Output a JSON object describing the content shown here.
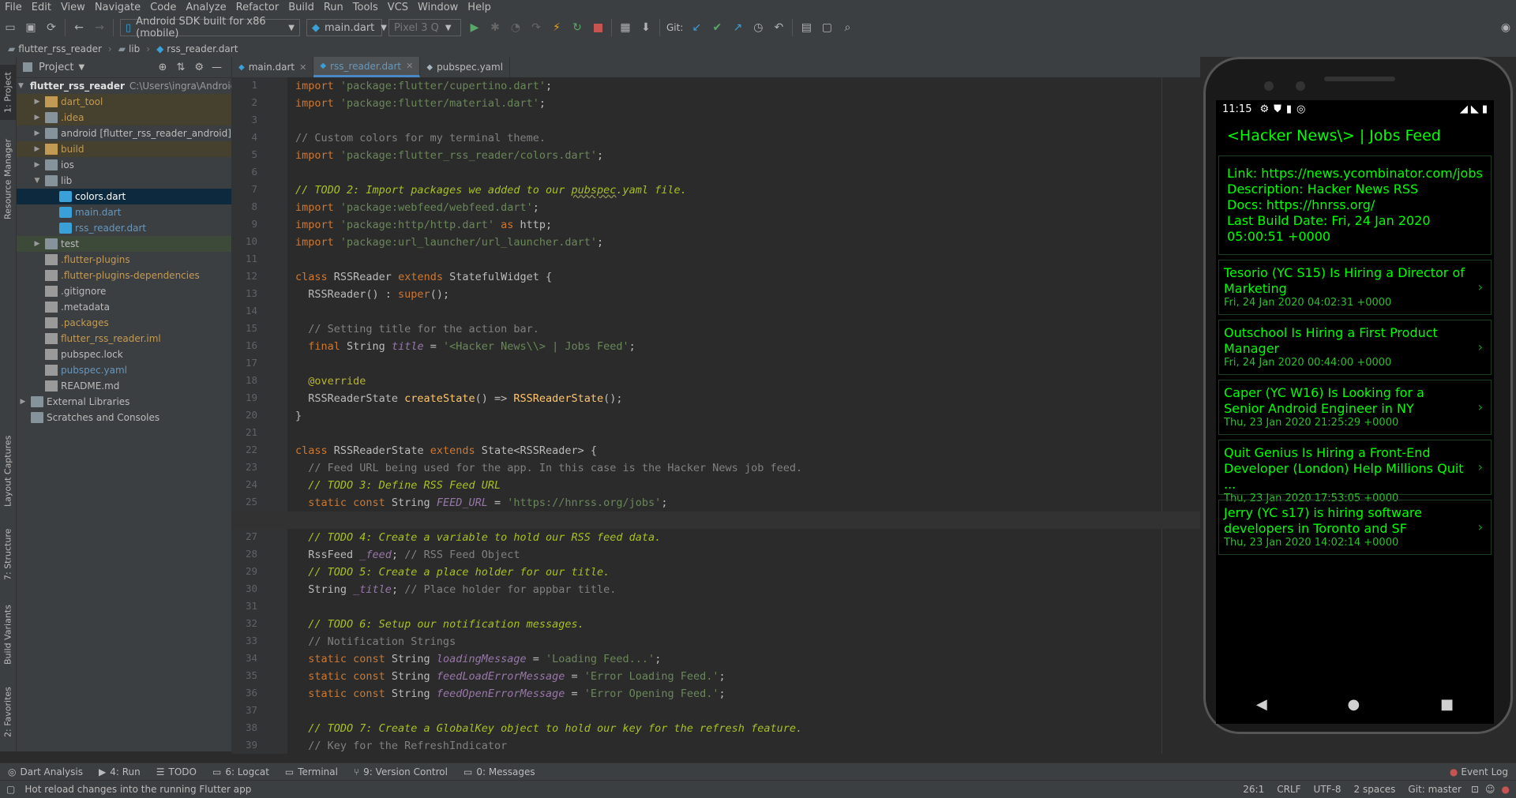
{
  "menu": [
    "File",
    "Edit",
    "View",
    "Navigate",
    "Code",
    "Analyze",
    "Refactor",
    "Build",
    "Run",
    "Tools",
    "VCS",
    "Window",
    "Help"
  ],
  "toolbar": {
    "device": "Android SDK built for x86 (mobile)",
    "run_config": "main.dart",
    "avd": "Pixel 3 Q",
    "git_label": "Git:"
  },
  "navbar": {
    "project": "flutter_rss_reader",
    "folder": "lib",
    "file": "rss_reader.dart"
  },
  "left_tabs": {
    "project": "1: Project",
    "resource": "Resource Manager",
    "layout": "Layout Captures",
    "structure": "7: Structure",
    "variants": "Build Variants",
    "favorites": "2: Favorites"
  },
  "project_panel": {
    "title": "Project",
    "root": "flutter_rss_reader",
    "root_path": "C:\\Users\\ingra\\AndroidS",
    "items": [
      {
        "label": "dart_tool",
        "indent": 1,
        "arrow": "▶",
        "icon": "folder-or",
        "color": "#c39a54"
      },
      {
        "label": ".idea",
        "indent": 1,
        "arrow": "▶",
        "icon": "folder",
        "color": "#c39a54"
      },
      {
        "label": "android [flutter_rss_reader_android]",
        "indent": 1,
        "arrow": "▶",
        "icon": "folder",
        "color": "#bbbbbb"
      },
      {
        "label": "build",
        "indent": 1,
        "arrow": "▶",
        "icon": "folder-or",
        "color": "#c39a54"
      },
      {
        "label": "ios",
        "indent": 1,
        "arrow": "▶",
        "icon": "folder",
        "color": "#bbbbbb"
      },
      {
        "label": "lib",
        "indent": 1,
        "arrow": "▼",
        "icon": "folder",
        "color": "#bbbbbb"
      },
      {
        "label": "colors.dart",
        "indent": 2,
        "arrow": "",
        "icon": "dartf",
        "color": "#ffffff"
      },
      {
        "label": "main.dart",
        "indent": 2,
        "arrow": "",
        "icon": "dartf",
        "color": "#6897bb"
      },
      {
        "label": "rss_reader.dart",
        "indent": 2,
        "arrow": "",
        "icon": "dartf",
        "color": "#6897bb"
      },
      {
        "label": "test",
        "indent": 1,
        "arrow": "▶",
        "icon": "folder",
        "color": "#bbbbbb"
      },
      {
        "label": ".flutter-plugins",
        "indent": 1,
        "arrow": "",
        "icon": "txtf",
        "color": "#c39a54"
      },
      {
        "label": ".flutter-plugins-dependencies",
        "indent": 1,
        "arrow": "",
        "icon": "txtf",
        "color": "#c39a54"
      },
      {
        "label": ".gitignore",
        "indent": 1,
        "arrow": "",
        "icon": "txtf",
        "color": "#bbbbbb"
      },
      {
        "label": ".metadata",
        "indent": 1,
        "arrow": "",
        "icon": "txtf",
        "color": "#bbbbbb"
      },
      {
        "label": ".packages",
        "indent": 1,
        "arrow": "",
        "icon": "txtf",
        "color": "#c39a54"
      },
      {
        "label": "flutter_rss_reader.iml",
        "indent": 1,
        "arrow": "",
        "icon": "txtf",
        "color": "#c39a54"
      },
      {
        "label": "pubspec.lock",
        "indent": 1,
        "arrow": "",
        "icon": "txtf",
        "color": "#bbbbbb"
      },
      {
        "label": "pubspec.yaml",
        "indent": 1,
        "arrow": "",
        "icon": "txtf",
        "color": "#6897bb"
      },
      {
        "label": "README.md",
        "indent": 1,
        "arrow": "",
        "icon": "txtf",
        "color": "#bbbbbb"
      },
      {
        "label": "External Libraries",
        "indent": 0,
        "arrow": "▶",
        "icon": "folder",
        "color": "#bbbbbb"
      },
      {
        "label": "Scratches and Consoles",
        "indent": 0,
        "arrow": "",
        "icon": "folder",
        "color": "#bbbbbb"
      }
    ]
  },
  "editor_tabs": [
    {
      "label": "main.dart",
      "active": false
    },
    {
      "label": "rss_reader.dart",
      "active": true
    },
    {
      "label": "pubspec.yaml",
      "active": false
    }
  ],
  "code_lines": [
    [
      {
        "c": "kw",
        "t": "import "
      },
      {
        "c": "str",
        "t": "'package:flutter/cupertino.dart'"
      },
      {
        "c": "",
        "t": ";"
      }
    ],
    [
      {
        "c": "kw",
        "t": "import "
      },
      {
        "c": "str",
        "t": "'package:flutter/material.dart'"
      },
      {
        "c": "",
        "t": ";"
      }
    ],
    [],
    [
      {
        "c": "cm",
        "t": "// Custom colors for my terminal theme."
      }
    ],
    [
      {
        "c": "kw",
        "t": "import "
      },
      {
        "c": "str",
        "t": "'package:flutter_rss_reader/colors.dart'"
      },
      {
        "c": "",
        "t": ";"
      }
    ],
    [],
    [
      {
        "c": "todo",
        "t": "// TODO 2: Import packages we added to our "
      },
      {
        "c": "todo ul",
        "t": "pubspec"
      },
      {
        "c": "todo",
        "t": ".yaml file."
      }
    ],
    [
      {
        "c": "kw",
        "t": "import "
      },
      {
        "c": "str",
        "t": "'package:webfeed/webfeed.dart'"
      },
      {
        "c": "",
        "t": ";"
      }
    ],
    [
      {
        "c": "kw",
        "t": "import "
      },
      {
        "c": "str",
        "t": "'package:http/http.dart' "
      },
      {
        "c": "kw",
        "t": "as "
      },
      {
        "c": "",
        "t": "http;"
      }
    ],
    [
      {
        "c": "kw",
        "t": "import "
      },
      {
        "c": "str",
        "t": "'package:url_launcher/url_launcher.dart'"
      },
      {
        "c": "",
        "t": ";"
      }
    ],
    [],
    [
      {
        "c": "kw",
        "t": "class "
      },
      {
        "c": "",
        "t": "RSSReader "
      },
      {
        "c": "kw",
        "t": "extends "
      },
      {
        "c": "",
        "t": "StatefulWidget {"
      }
    ],
    [
      {
        "c": "",
        "t": "  RSSReader() : "
      },
      {
        "c": "kw",
        "t": "super"
      },
      {
        "c": "",
        "t": "();"
      }
    ],
    [],
    [
      {
        "c": "cm",
        "t": "  // Setting title for the action bar."
      }
    ],
    [
      {
        "c": "kw",
        "t": "  final "
      },
      {
        "c": "",
        "t": "String "
      },
      {
        "c": "fld",
        "t": "title"
      },
      {
        "c": "",
        "t": " = "
      },
      {
        "c": "str",
        "t": "'<Hacker News\\\\> | Jobs Feed'"
      },
      {
        "c": "",
        "t": ";"
      }
    ],
    [],
    [
      {
        "c": "ann",
        "t": "  @override"
      }
    ],
    [
      {
        "c": "",
        "t": "  RSSReaderState "
      },
      {
        "c": "fn",
        "t": "createState"
      },
      {
        "c": "",
        "t": "() => "
      },
      {
        "c": "fn",
        "t": "RSSReaderState"
      },
      {
        "c": "",
        "t": "();"
      }
    ],
    [
      {
        "c": "",
        "t": "}"
      }
    ],
    [],
    [
      {
        "c": "kw",
        "t": "class "
      },
      {
        "c": "",
        "t": "RSSReaderState "
      },
      {
        "c": "kw",
        "t": "extends "
      },
      {
        "c": "",
        "t": "State<RSSReader> {"
      }
    ],
    [
      {
        "c": "cm",
        "t": "  // Feed URL being used for the app. In this case is the Hacker News job feed."
      }
    ],
    [
      {
        "c": "todo",
        "t": "  // TODO 3: Define RSS Feed URL"
      }
    ],
    [
      {
        "c": "kw",
        "t": "  static const "
      },
      {
        "c": "",
        "t": "String "
      },
      {
        "c": "fld",
        "t": "FEED_URL"
      },
      {
        "c": "",
        "t": " = "
      },
      {
        "c": "str",
        "t": "'https://hnrss.org/jobs'"
      },
      {
        "c": "",
        "t": ";"
      }
    ],
    [],
    [
      {
        "c": "todo",
        "t": "  // TODO 4: Create a variable to hold our RSS feed data."
      }
    ],
    [
      {
        "c": "",
        "t": "  RssFeed "
      },
      {
        "c": "fld",
        "t": "_feed"
      },
      {
        "c": "",
        "t": "; "
      },
      {
        "c": "cm",
        "t": "// RSS Feed Object"
      }
    ],
    [
      {
        "c": "todo",
        "t": "  // TODO 5: Create a place holder for our title."
      }
    ],
    [
      {
        "c": "",
        "t": "  String "
      },
      {
        "c": "fld",
        "t": "_title"
      },
      {
        "c": "",
        "t": "; "
      },
      {
        "c": "cm",
        "t": "// Place holder for appbar title."
      }
    ],
    [],
    [
      {
        "c": "todo",
        "t": "  // TODO 6: Setup our notification messages."
      }
    ],
    [
      {
        "c": "cm",
        "t": "  // Notification Strings"
      }
    ],
    [
      {
        "c": "kw",
        "t": "  static const "
      },
      {
        "c": "",
        "t": "String "
      },
      {
        "c": "fld",
        "t": "loadingMessage"
      },
      {
        "c": "",
        "t": " = "
      },
      {
        "c": "str",
        "t": "'Loading Feed...'"
      },
      {
        "c": "",
        "t": ";"
      }
    ],
    [
      {
        "c": "kw",
        "t": "  static const "
      },
      {
        "c": "",
        "t": "String "
      },
      {
        "c": "fld",
        "t": "feedLoadErrorMessage"
      },
      {
        "c": "",
        "t": " = "
      },
      {
        "c": "str",
        "t": "'Error Loading Feed.'"
      },
      {
        "c": "",
        "t": ";"
      }
    ],
    [
      {
        "c": "kw",
        "t": "  static const "
      },
      {
        "c": "",
        "t": "String "
      },
      {
        "c": "fld",
        "t": "feedOpenErrorMessage"
      },
      {
        "c": "",
        "t": " = "
      },
      {
        "c": "str",
        "t": "'Error Opening Feed.'"
      },
      {
        "c": "",
        "t": ";"
      }
    ],
    [],
    [
      {
        "c": "todo",
        "t": "  // TODO 7: Create a GlobalKey object to hold our key for the refresh feature."
      }
    ],
    [
      {
        "c": "cm",
        "t": "  // Key for the RefreshIndicator"
      }
    ]
  ],
  "bottom_tabs": [
    "Dart Analysis",
    "4: Run",
    "TODO",
    "6: Logcat",
    "Terminal",
    "9: Version Control",
    "0: Messages"
  ],
  "event_log": "Event Log",
  "status": {
    "message": "Hot reload changes into the running Flutter app",
    "position": "26:1",
    "line_sep": "CRLF",
    "encoding": "UTF-8",
    "indent": "2 spaces",
    "git": "Git: master"
  },
  "phone": {
    "time": "11:15",
    "app_title": "<Hacker News\\> | Jobs Feed",
    "feed_info": [
      "Link: https://news.ycombinator.com/jobs",
      "Description: Hacker News RSS",
      "Docs: https://hnrss.org/",
      "Last Build Date: Fri, 24 Jan 2020 05:00:51 +0000"
    ],
    "items": [
      {
        "title": "Tesorio (YC S15) Is Hiring a Director of Marketing",
        "date": "Fri, 24 Jan 2020 04:02:31 +0000"
      },
      {
        "title": "Outschool Is Hiring a First Product Manager",
        "date": "Fri, 24 Jan 2020 00:44:00 +0000"
      },
      {
        "title": "Caper (YC W16) Is Looking for a Senior Android Engineer in NY",
        "date": "Thu, 23 Jan 2020 21:25:29 +0000"
      },
      {
        "title": "Quit Genius Is Hiring a Front-End Developer (London) Help Millions Quit ...",
        "date": "Thu, 23 Jan 2020 17:53:05 +0000"
      },
      {
        "title": "Jerry (YC s17) is hiring software developers in Toronto and SF",
        "date": "Thu, 23 Jan 2020 14:02:14 +0000"
      }
    ]
  }
}
